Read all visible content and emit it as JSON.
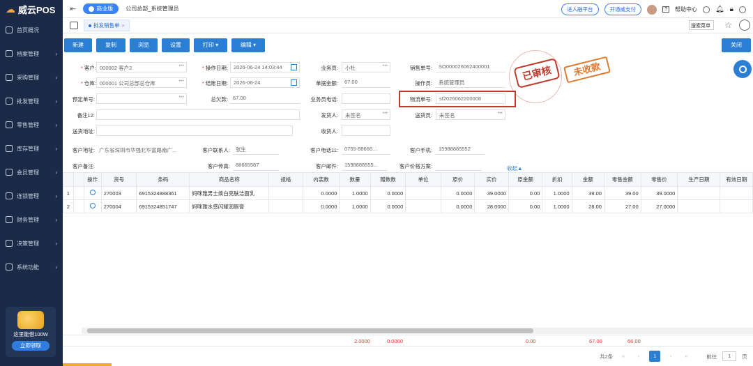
{
  "app": {
    "logo": "威云POS",
    "edition": "商业版",
    "breadcrumb": "公司总部_系统管理员"
  },
  "top": {
    "enter_platform": "进入融平台",
    "open_pay": "开通威支付",
    "help": "帮助中心"
  },
  "sidebar": {
    "items": [
      {
        "label": "首页概况",
        "icon": "home-icon"
      },
      {
        "label": "档案管理",
        "icon": "folder-icon"
      },
      {
        "label": "采购管理",
        "icon": "cart-icon"
      },
      {
        "label": "批发管理",
        "icon": "wholesale-icon"
      },
      {
        "label": "零售管理",
        "icon": "retail-icon"
      },
      {
        "label": "库存管理",
        "icon": "inventory-icon"
      },
      {
        "label": "会员管理",
        "icon": "member-icon"
      },
      {
        "label": "连锁管理",
        "icon": "chain-icon"
      },
      {
        "label": "财务管理",
        "icon": "finance-icon"
      },
      {
        "label": "决策管理",
        "icon": "decision-icon"
      },
      {
        "label": "系统功能",
        "icon": "settings-icon"
      }
    ],
    "promo_text": "这里能借100W",
    "promo_btn": "立即领取"
  },
  "tabs": {
    "active": "批发销售单",
    "search_placeholder": "搜索菜单"
  },
  "toolbar": {
    "new": "新建",
    "copy": "复制",
    "browse": "浏览",
    "settings": "设置",
    "print": "打印",
    "edit": "编辑",
    "close": "关闭"
  },
  "form": {
    "customer_label": "客户:",
    "customer": "000002 客户2",
    "op_date_label": "操作日期:",
    "op_date": "2026-06-24 14:03:44",
    "salesman_label": "业务员:",
    "salesman": "小杜",
    "sale_no_label": "销售单号:",
    "sale_no": "SO000026062400001",
    "warehouse_label": "仓库:",
    "warehouse": "000001 公司总部总仓库",
    "settle_date_label": "结账日期:",
    "settle_date": "2026-06-24",
    "doc_amount_label": "单据金额:",
    "doc_amount": "67.00",
    "operator_label": "操作员:",
    "operator": "系统管理员",
    "preorder_label": "预定单号:",
    "debt_label": "总欠款:",
    "debt": "67.00",
    "salesman_phone_label": "业务员电话:",
    "logistics_label": "物流单号:",
    "logistics": "sf2026062200008",
    "remark_label": "备注12:",
    "shipper_label": "发货人:",
    "shipper": "未签名",
    "deliverer_label": "送货员:",
    "deliverer": "未签名",
    "ship_addr_label": "送货地址:",
    "receiver_label": "收货人:",
    "cust_addr_label": "客户地址:",
    "cust_addr": "广东省深圳市华强北华富路南广...",
    "contact_label": "客户联系人:",
    "contact": "张生",
    "phone11_label": "客户电话11:",
    "phone11": "0755-88666...",
    "mobile_label": "客户手机:",
    "mobile": "15988885552",
    "cust_remark_label": "客户备注:",
    "fax_label": "客户传真:",
    "fax": "88665587",
    "email_label": "客户邮件:",
    "email": "1598888555...",
    "price_plan_label": "客户价格方案:",
    "collapse": "收起▲"
  },
  "stamps": {
    "audited": "已审核",
    "unpaid": "未收款"
  },
  "table": {
    "headers": [
      "",
      "",
      "操作",
      "货号",
      "条码",
      "商品名称",
      "规格",
      "内装数",
      "数量",
      "赠数数",
      "单位",
      "原价",
      "实价",
      "原金额",
      "折扣",
      "金额",
      "零售金额",
      "零售价",
      "生产日期",
      "有效日期"
    ],
    "rows": [
      [
        "1",
        "",
        "",
        "270003",
        "6915324888361",
        "妈咪雅男士焕白亮肤洁面乳",
        "",
        "0.0000",
        "1.0000",
        "0.0000",
        "",
        "0.0000",
        "39.0000",
        "0.00",
        "1.0000",
        "39.00",
        "39.00",
        "39.0000",
        "",
        ""
      ],
      [
        "2",
        "",
        "",
        "270004",
        "6915324851747",
        "妈咪雅水感闪耀润唇膏",
        "",
        "0.0000",
        "1.0000",
        "0.0000",
        "",
        "0.0000",
        "28.0000",
        "0.00",
        "1.0000",
        "28.00",
        "27.00",
        "27.0000",
        "",
        ""
      ]
    ],
    "totals": {
      "qty": "2.0000",
      "gift": "0.0000",
      "orig_amount": "0.00",
      "amount": "67.00",
      "retail_amount": "66.00"
    }
  },
  "pager": {
    "total": "共2条",
    "current": "1",
    "goto": "前往",
    "page_input": "1",
    "page_unit": "页"
  },
  "colors": {
    "sidebar": "#1b2a47",
    "accent": "#2a7fd4",
    "stamp_red": "#c0392b",
    "stamp_orange": "#e07a30"
  }
}
